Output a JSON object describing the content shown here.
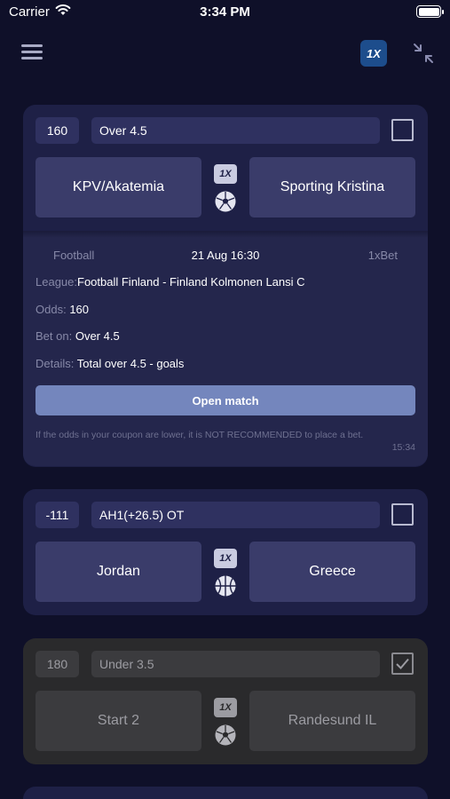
{
  "status_bar": {
    "carrier": "Carrier",
    "time": "3:34 PM"
  },
  "header": {
    "logo_text": "1X"
  },
  "cards": [
    {
      "odds": "160",
      "bet": "Over 4.5",
      "team_home": "KPV/Akatemia",
      "team_away": "Sporting Kristina",
      "sport_icon": "soccer-ball-icon",
      "checked": false,
      "expanded": true,
      "details": {
        "sport": "Football",
        "date": "21 Aug 16:30",
        "bookmaker": "1xBet",
        "league_label": "League:",
        "league_value": "Football Finland - Finland Kolmonen Lansi C",
        "odds_label": "Odds:",
        "odds_value": "160",
        "bet_label": "Bet on:",
        "bet_value": "Over 4.5",
        "details_label": "Details:",
        "details_value": "Total over 4.5 - goals",
        "open_button": "Open match",
        "warning": "If the odds in your coupon are lower, it is NOT RECOMMENDED to place a bet.",
        "time": "15:34"
      }
    },
    {
      "odds": "-111",
      "bet": "AH1(+26.5) OT",
      "team_home": "Jordan",
      "team_away": "Greece",
      "sport_icon": "basketball-icon",
      "checked": false,
      "expanded": false
    },
    {
      "odds": "180",
      "bet": "Under 3.5",
      "team_home": "Start 2",
      "team_away": "Randesund IL",
      "sport_icon": "soccer-ball-icon",
      "checked": true,
      "expanded": false
    }
  ],
  "colors": {
    "background": "#0f1029",
    "card": "#1e2046",
    "card_done": "#2a2a2c",
    "field": "#2f3160",
    "team_button": "#3a3c6a",
    "open_button": "#7486bd",
    "logo": "#1d4d8c"
  }
}
